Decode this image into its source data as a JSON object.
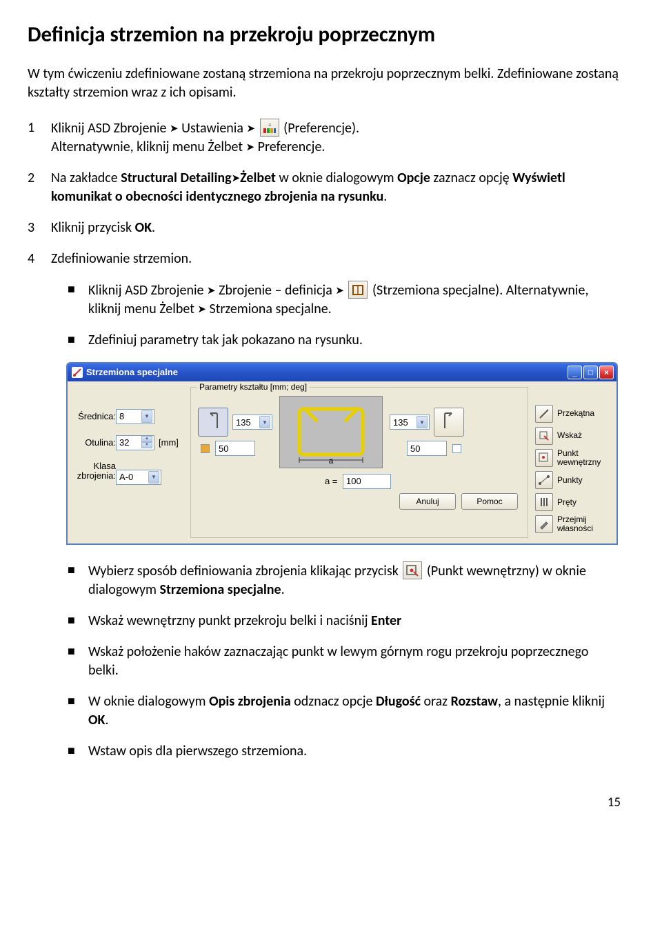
{
  "heading": "Definicja strzemion na przekroju poprzecznym",
  "intro": "W tym ćwiczeniu zdefiniowane zostaną strzemiona na przekroju poprzecznym belki. Zdefiniowane zostaną kształty strzemion wraz z ich opisami.",
  "steps": {
    "s1": {
      "num": "1",
      "p1a": "Kliknij ASD Zbrojenie ",
      "p1b": " Ustawienia ",
      "p1c": " (Preferencje).",
      "p2a": "Alternatywnie, kliknij menu Żelbet ",
      "p2b": " Preferencje."
    },
    "s2": {
      "num": "2",
      "p1a": "Na zakładce ",
      "p1b": "Structural Detailing",
      "p1c": "Żelbet",
      "p1d": " w oknie dialogowym ",
      "p1e": "Opcje",
      "p1f": " zaznacz opcję ",
      "p1g": "Wyświetl komunikat o obecności identycznego zbrojenia na rysunku",
      "p1h": "."
    },
    "s3": {
      "num": "3",
      "t1": "Kliknij przycisk ",
      "t2": "OK",
      "t3": "."
    },
    "s4": {
      "num": "4",
      "t": "Zdefiniowanie strzemion."
    }
  },
  "subs1": {
    "a": {
      "p1a": "Kliknij ASD Zbrojenie ",
      "p1b": " Zbrojenie – definicja ",
      "p1c": " (Strzemiona specjalne). Alternatywnie, kliknij menu Żelbet ",
      "p1d": " Strzemiona specjalne."
    },
    "b": {
      "t": "Zdefiniuj parametry tak jak pokazano na rysunku."
    }
  },
  "dialog": {
    "title": "Strzemiona specjalne",
    "left": {
      "srednica_label": "Średnica:",
      "srednica_val": "8",
      "otulina_label": "Otulina:",
      "otulina_val": "32",
      "otulina_unit": "[mm]",
      "klasa_label": "Klasa zbrojenia:",
      "klasa_val": "A-0"
    },
    "fieldset": {
      "legend": "Parametry kształtu [mm; deg]",
      "top_left": "135",
      "top_right": "135",
      "bot_left": "50",
      "bot_right": "50",
      "a_label": "a =",
      "a_val": "100",
      "preview_label": "a"
    },
    "right": {
      "r1": "Przekątna",
      "r2": "Wskaż",
      "r3": "Punkt wewnętrzny",
      "r4": "Punkty",
      "r5": "Pręty",
      "r6": "Przejmij własności"
    },
    "buttons": {
      "anuluj": "Anuluj",
      "pomoc": "Pomoc"
    }
  },
  "subs2": {
    "a": {
      "p1a": "Wybierz sposób definiowania zbrojenia klikając przycisk ",
      "p1b": " (Punkt wewnętrzny) w oknie dialogowym ",
      "p1c": "Strzemiona specjalne",
      "p1d": "."
    },
    "b": {
      "t1": "Wskaż wewnętrzny punkt przekroju belki i naciśnij ",
      "t2": "Enter"
    },
    "c": {
      "t": "Wskaż położenie haków zaznaczając punkt w lewym górnym rogu przekroju poprzecznego belki."
    },
    "d": {
      "t1": "W oknie dialogowym ",
      "t2": "Opis zbrojenia",
      "t3": " odznacz opcje ",
      "t4": "Długość",
      "t5": " oraz ",
      "t6": "Rozstaw",
      "t7": ", a następnie kliknij ",
      "t8": "OK",
      "t9": "."
    },
    "e": {
      "t": "Wstaw opis dla pierwszego strzemiona."
    }
  },
  "page": "15"
}
